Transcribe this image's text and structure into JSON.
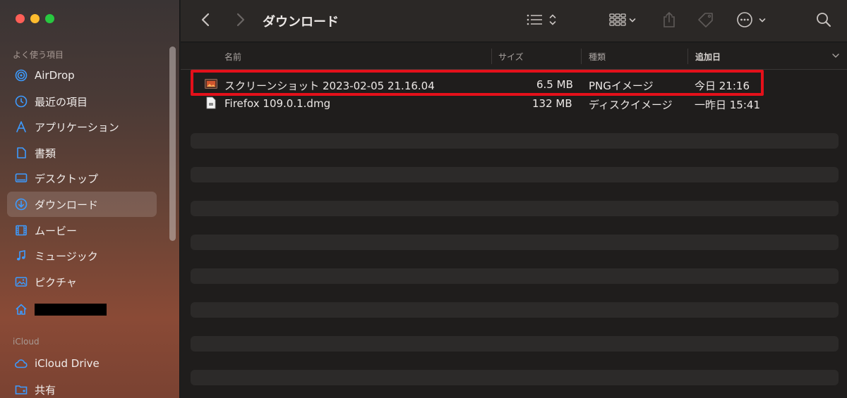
{
  "sidebar": {
    "favorites_title": "よく使う項目",
    "items": [
      {
        "label": "AirDrop",
        "icon": "airdrop-icon"
      },
      {
        "label": "最近の項目",
        "icon": "clock-icon"
      },
      {
        "label": "アプリケーション",
        "icon": "applications-icon"
      },
      {
        "label": "書類",
        "icon": "document-icon"
      },
      {
        "label": "デスクトップ",
        "icon": "desktop-icon"
      },
      {
        "label": "ダウンロード",
        "icon": "download-icon",
        "selected": true
      },
      {
        "label": "ムービー",
        "icon": "film-icon"
      },
      {
        "label": "ミュージック",
        "icon": "music-icon"
      },
      {
        "label": "ピクチャ",
        "icon": "photo-icon"
      },
      {
        "label": "",
        "icon": "home-icon",
        "redacted": true
      }
    ],
    "icloud_title": "iCloud",
    "icloud_items": [
      {
        "label": "iCloud Drive",
        "icon": "cloud-icon"
      },
      {
        "label": "共有",
        "icon": "shared-folder-icon"
      }
    ]
  },
  "toolbar": {
    "title": "ダウンロード"
  },
  "columns": {
    "name": "名前",
    "size": "サイズ",
    "kind": "種類",
    "date_added": "追加日"
  },
  "files": [
    {
      "name": "スクリーンショット 2023-02-05 21.16.04",
      "size": "6.5 MB",
      "kind": "PNGイメージ",
      "date": "今日 21:16",
      "icon": "image-file-icon",
      "highlighted": true
    },
    {
      "name": "Firefox 109.0.1.dmg",
      "size": "132 MB",
      "kind": "ディスクイメージ",
      "date": "一昨日 15:41",
      "icon": "disk-image-file-icon"
    }
  ],
  "colors": {
    "accent_blue": "#3d9bff",
    "highlight_red": "#e4101a"
  }
}
